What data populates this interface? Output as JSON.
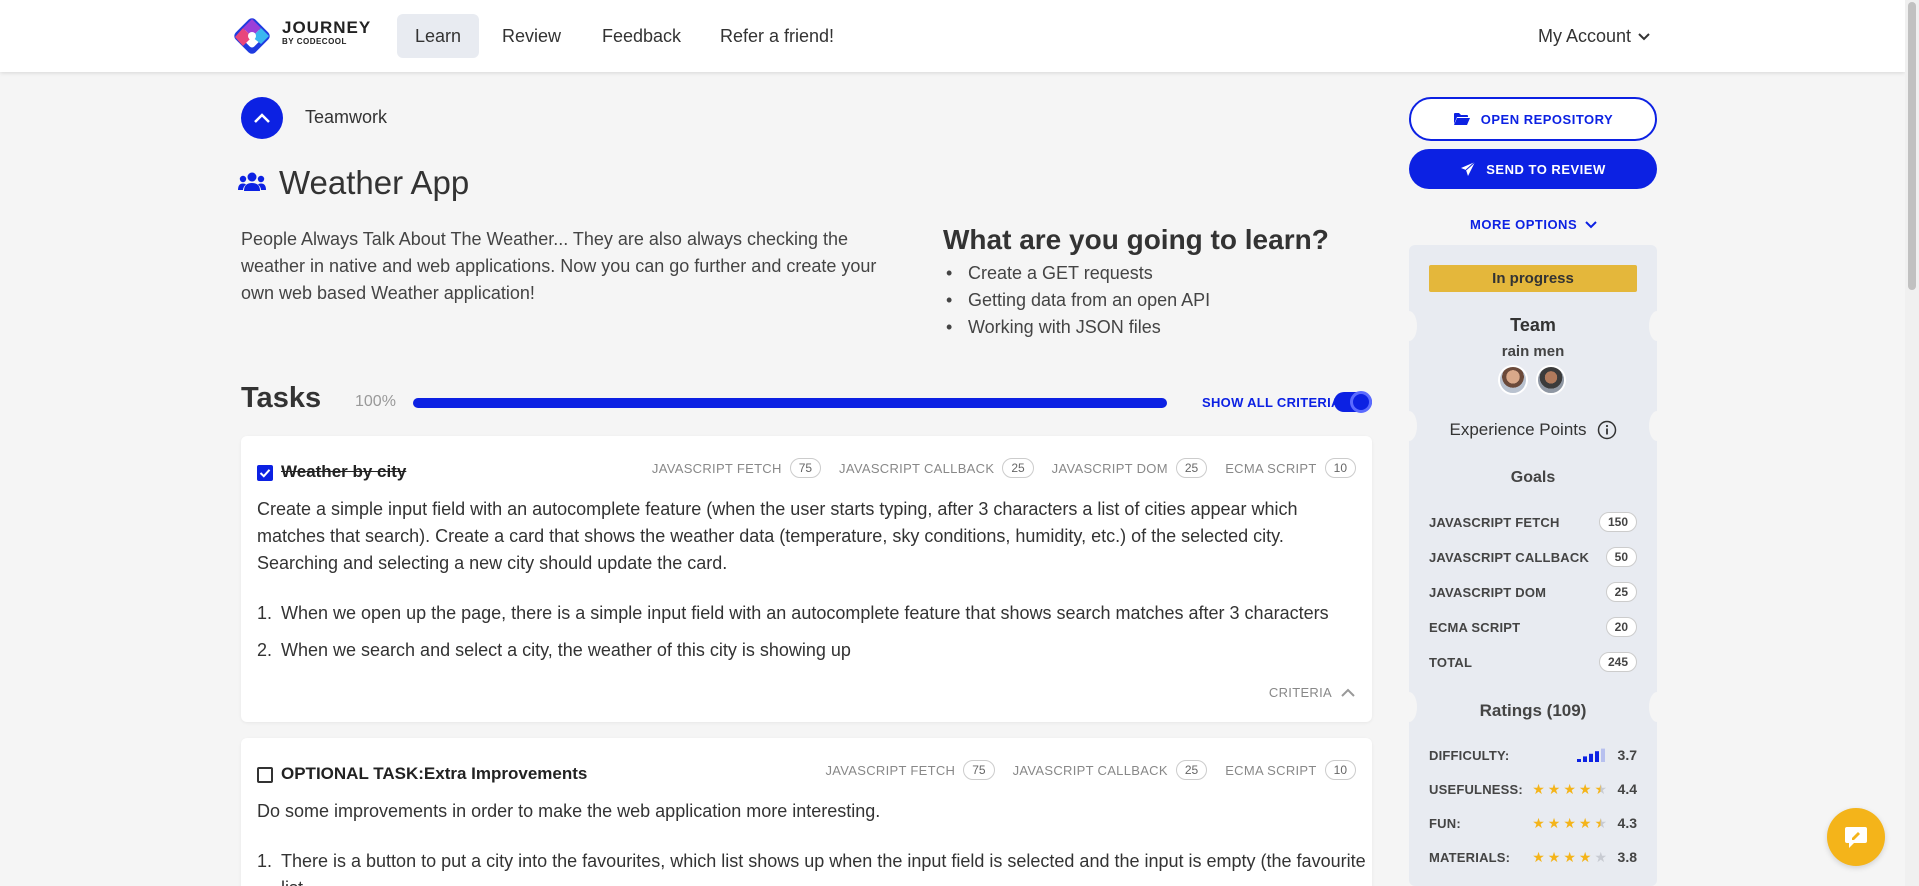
{
  "nav": {
    "logo_main": "JOURNEY",
    "logo_sub": "BY CODECOOL",
    "items": [
      {
        "label": "Learn",
        "active": true
      },
      {
        "label": "Review",
        "active": false
      },
      {
        "label": "Feedback",
        "active": false
      },
      {
        "label": "Refer a friend!",
        "active": false
      }
    ],
    "account": "My Account"
  },
  "breadcrumb": "Teamwork",
  "project": {
    "title": "Weather App",
    "description": "People Always Talk About The Weather... They are also always checking the weather in native and web applications. Now you can go further and create your own web based Weather application!",
    "learn_title": "What are you going to learn?",
    "learn_items": [
      "Create a GET requests",
      "Getting data from an open API",
      "Working with JSON files"
    ]
  },
  "tasks": {
    "title": "Tasks",
    "progress_label": "100%",
    "progress": 1.0,
    "show_all_criteria": "SHOW ALL CRITERIA",
    "items": [
      {
        "title": "Weather by city",
        "done": true,
        "tags": [
          {
            "name": "JAVASCRIPT FETCH",
            "value": "75"
          },
          {
            "name": "JAVASCRIPT CALLBACK",
            "value": "25"
          },
          {
            "name": "JAVASCRIPT DOM",
            "value": "25"
          },
          {
            "name": "ECMA SCRIPT",
            "value": "10"
          }
        ],
        "body": "Create a simple input field with an autocomplete feature (when the user starts typing, after 3 characters a list of cities appear which matches that search). Create a card that shows the weather data (temperature, sky conditions, humidity, etc.) of the selected city. Searching and selecting a new city should update the card.",
        "criteria": [
          "When we open up the page, there is a simple input field with an autocomplete feature that shows search matches after 3 characters",
          "When we search and select a city, the weather of this city is showing up"
        ],
        "criteria_label": "CRITERIA"
      },
      {
        "title": "OPTIONAL TASK:Extra Improvements",
        "done": false,
        "tags": [
          {
            "name": "JAVASCRIPT FETCH",
            "value": "75"
          },
          {
            "name": "JAVASCRIPT CALLBACK",
            "value": "25"
          },
          {
            "name": "ECMA SCRIPT",
            "value": "10"
          }
        ],
        "body": "Do some improvements in order to make the web application more interesting.",
        "criteria": [
          "There is a button to put a city into the favourites, which list shows up when the input field is selected and the input is empty (the favourite list"
        ]
      }
    ]
  },
  "sidebar": {
    "open_repo": "OPEN REPOSITORY",
    "send_review": "SEND TO REVIEW",
    "more_options": "MORE OPTIONS",
    "status": "In progress",
    "team_label": "Team",
    "team_name": "rain men",
    "xp_title": "Experience Points",
    "goals_title": "Goals",
    "goals": [
      {
        "name": "JAVASCRIPT FETCH",
        "value": "150"
      },
      {
        "name": "JAVASCRIPT CALLBACK",
        "value": "50"
      },
      {
        "name": "JAVASCRIPT DOM",
        "value": "25"
      },
      {
        "name": "ECMA SCRIPT",
        "value": "20"
      },
      {
        "name": "TOTAL",
        "value": "245"
      }
    ],
    "ratings_title": "Ratings (109)",
    "ratings": [
      {
        "name": "DIFFICULTY:",
        "value": "3.7",
        "kind": "bars",
        "score": 3.7
      },
      {
        "name": "USEFULNESS:",
        "value": "4.4",
        "kind": "stars",
        "score": 4.4
      },
      {
        "name": "FUN:",
        "value": "4.3",
        "kind": "stars",
        "score": 4.3
      },
      {
        "name": "MATERIALS:",
        "value": "3.8",
        "kind": "stars",
        "score": 3.8
      }
    ]
  },
  "colors": {
    "accent": "#0c21e3",
    "status": "#e4b73b",
    "star": "#f4b41a",
    "chat": "#f4b41a"
  }
}
